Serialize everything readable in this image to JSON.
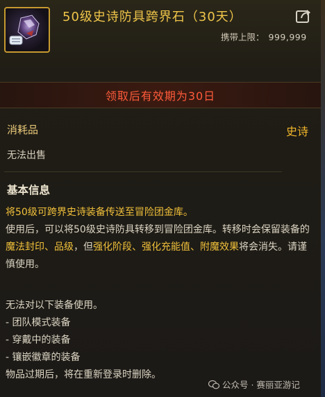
{
  "item": {
    "title": "50级史诗防具跨界石（30天）",
    "carry_limit_label": "携带上限：",
    "carry_limit_value": "999,999",
    "share_icon": "share-icon",
    "item_icon": "armor-crossover-stone-icon"
  },
  "banner": {
    "validity_text": "领取后有效期为30日"
  },
  "attributes": {
    "type_label": "消耗品",
    "grade_label": "史诗",
    "trade_text": "无法出售"
  },
  "basic_info": {
    "title": "基本信息",
    "line1": "将50级可跨界史诗装备传送至冒险团金库。",
    "line2_prefix": "使用后，可以将50级史诗防具转移到冒险团金库。转移时会保留装备的",
    "line2_hl1": "魔法封印、品级",
    "line2_mid": "，但",
    "line2_hl2": "强化阶段、强化充能值、附魔效果",
    "line2_suffix": "将会消失。请谨慎使用。",
    "restrict_title": "无法对以下装备使用。",
    "restrict_items": [
      "- 团队模式装备",
      "- 穿戴中的装备",
      "- 镶嵌徽章的装备"
    ],
    "expire_note": "物品过期后，将在重新登录时删除。"
  },
  "watermark": {
    "text": "公众号 · 赛丽亚游记",
    "icon": "wechat-icon"
  },
  "colors": {
    "title": "#f0c64a",
    "banner_text": "#ff5a3a",
    "grade": "#f1b62a",
    "highlight": "#f0c03a"
  }
}
